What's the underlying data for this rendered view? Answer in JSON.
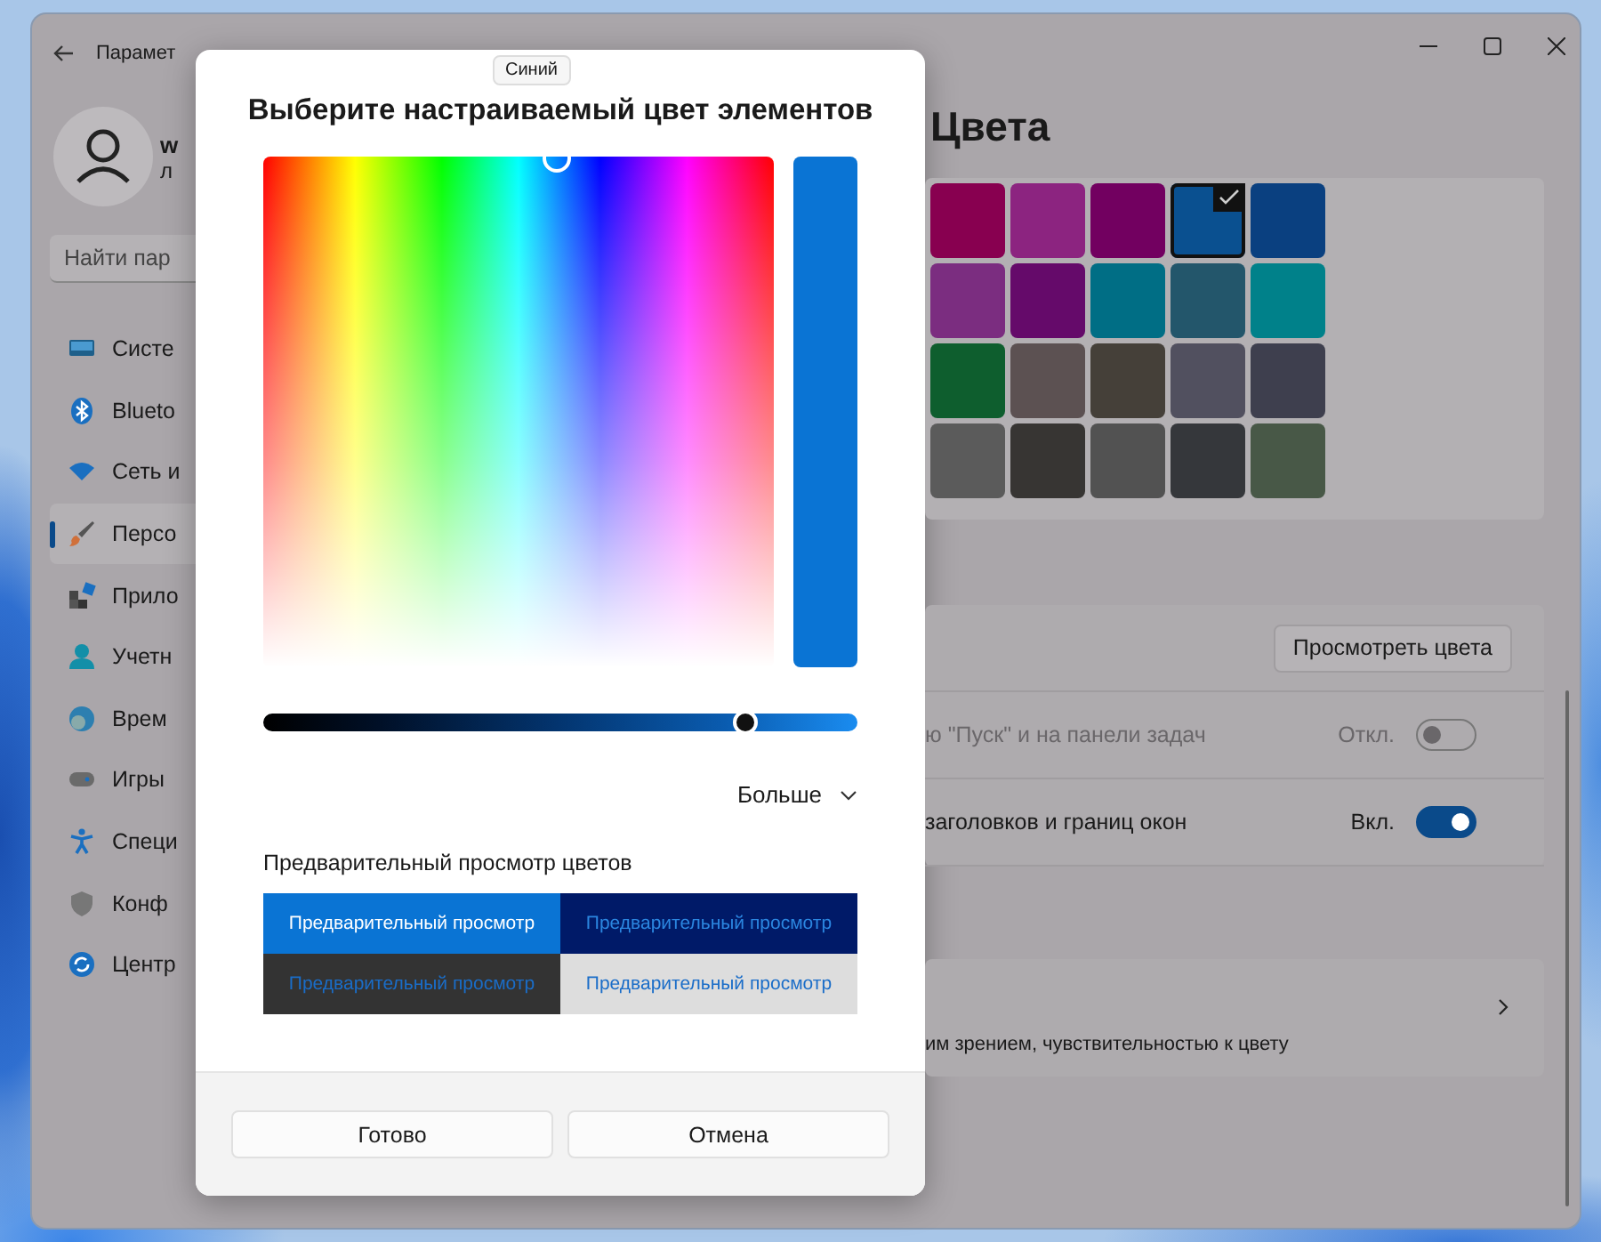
{
  "window": {
    "title": "Парамет"
  },
  "account": {
    "name": "w",
    "subtitle": "л"
  },
  "search": {
    "placeholder": "Найти пар"
  },
  "sidebar": {
    "items": [
      {
        "label": "Систе",
        "selected": false
      },
      {
        "label": "Blueto",
        "selected": false
      },
      {
        "label": "Сеть и",
        "selected": false
      },
      {
        "label": "Персо",
        "selected": true
      },
      {
        "label": "Прило",
        "selected": false
      },
      {
        "label": "Учетн",
        "selected": false
      },
      {
        "label": "Врем",
        "selected": false
      },
      {
        "label": "Игры",
        "selected": false
      },
      {
        "label": "Специ",
        "selected": false
      },
      {
        "label": "Конф",
        "selected": false
      },
      {
        "label": "Центр",
        "selected": false
      }
    ]
  },
  "page": {
    "heading": "Цвета"
  },
  "swatches": [
    {
      "color": "#880050",
      "selected": false
    },
    {
      "color": "#8c2480",
      "selected": false
    },
    {
      "color": "#720060",
      "selected": false
    },
    {
      "color": "#0a5090",
      "selected": true
    },
    {
      "color": "#0a4080",
      "selected": false
    },
    {
      "color": "#7b2d80",
      "selected": false
    },
    {
      "color": "#650a6a",
      "selected": false
    },
    {
      "color": "#006e85",
      "selected": false
    },
    {
      "color": "#23566b",
      "selected": false
    },
    {
      "color": "#00818a",
      "selected": false
    },
    {
      "color": "#0e5e2e",
      "selected": false
    },
    {
      "color": "#5c5152",
      "selected": false
    },
    {
      "color": "#454039",
      "selected": false
    },
    {
      "color": "#51505f",
      "selected": false
    },
    {
      "color": "#3e3f4e",
      "selected": false
    },
    {
      "color": "#5b5b5b",
      "selected": false
    },
    {
      "color": "#373533",
      "selected": false
    },
    {
      "color": "#525252",
      "selected": false
    },
    {
      "color": "#35373b",
      "selected": false
    },
    {
      "color": "#485847",
      "selected": false
    }
  ],
  "settings_rows": [
    {
      "kind": "button",
      "button": "Просмотреть цвета"
    },
    {
      "kind": "toggle",
      "label": "ю \"Пуск\" и на панели задач",
      "state": "Откл.",
      "on": false,
      "disabled": true
    },
    {
      "kind": "toggle",
      "label": "заголовков и границ окон",
      "state": "Вкл.",
      "on": true,
      "disabled": false
    }
  ],
  "link_card": {
    "label": "им зрением, чувствительностью к цвету"
  },
  "dialog": {
    "tooltip": "Синий",
    "title": "Выберите настраиваемый цвет элементов",
    "brightness": {
      "level": 0.81
    },
    "more": "Больше",
    "preview_label": "Предварительный просмотр цветов",
    "previews": [
      {
        "kind": "accent",
        "text": "Предварительный просмотр"
      },
      {
        "kind": "dark-accent",
        "text": "Предварительный просмотр"
      },
      {
        "kind": "dark",
        "text": "Предварительный просмотр"
      },
      {
        "kind": "light",
        "text": "Предварительный просмотр"
      }
    ],
    "buttons": [
      "Готово",
      "Отмена"
    ]
  }
}
